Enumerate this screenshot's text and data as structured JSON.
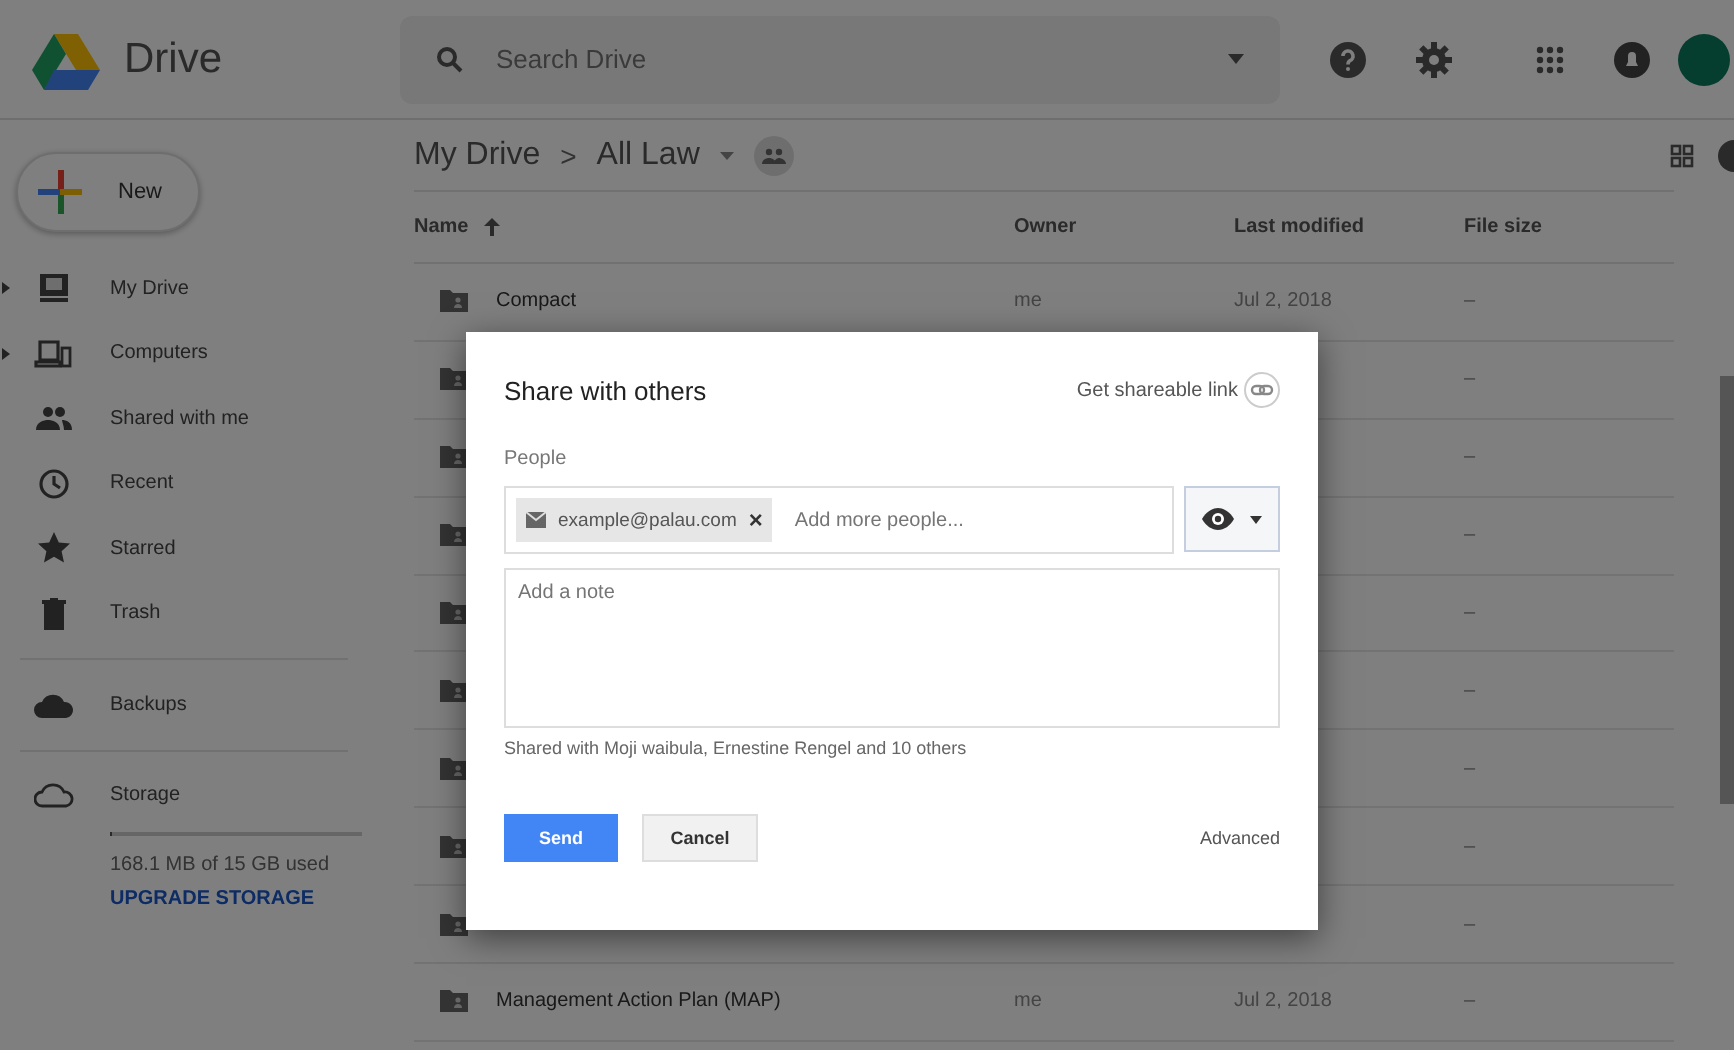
{
  "app": {
    "name": "Drive"
  },
  "search": {
    "placeholder": "Search Drive"
  },
  "new_button": "New",
  "sidebar": {
    "items": [
      {
        "label": "My Drive",
        "expandable": true
      },
      {
        "label": "Computers",
        "expandable": true
      },
      {
        "label": "Shared with me",
        "expandable": false
      },
      {
        "label": "Recent",
        "expandable": false
      },
      {
        "label": "Starred",
        "expandable": false
      },
      {
        "label": "Trash",
        "expandable": false
      }
    ],
    "backups": "Backups",
    "storage": {
      "label": "Storage",
      "level": 0.01,
      "usage": "168.1 MB of 15 GB used",
      "upgrade": "UPGRADE STORAGE"
    }
  },
  "breadcrumb": [
    "My Drive",
    "All Law"
  ],
  "breadcrumb_separator": ">",
  "table": {
    "columns": [
      "Name",
      "Owner",
      "Last modified",
      "File size"
    ],
    "rows": [
      {
        "name": "Compact",
        "owner": "me",
        "modified": "Jul 2, 2018",
        "size": "–"
      },
      {
        "size": "–"
      },
      {
        "size": "–"
      },
      {
        "size": "–"
      },
      {
        "size": "–"
      },
      {
        "size": "–"
      },
      {
        "size": "–"
      },
      {
        "size": "–"
      },
      {
        "size": "–"
      },
      {
        "name": "Management Action Plan (MAP)",
        "owner": "me",
        "modified": "Jul 2, 2018",
        "size": "–"
      }
    ]
  },
  "dialog": {
    "title": "Share with others",
    "link": "Get shareable link",
    "people_label": "People",
    "chips": [
      "example@palau.com"
    ],
    "chip_remove": "×",
    "people_placeholder": "Add more people...",
    "note_placeholder": "Add a note",
    "shared_with": "Shared with Moji waibula, Ernestine Rengel and 10 others",
    "send": "Send",
    "cancel": "Cancel",
    "advanced": "Advanced"
  }
}
